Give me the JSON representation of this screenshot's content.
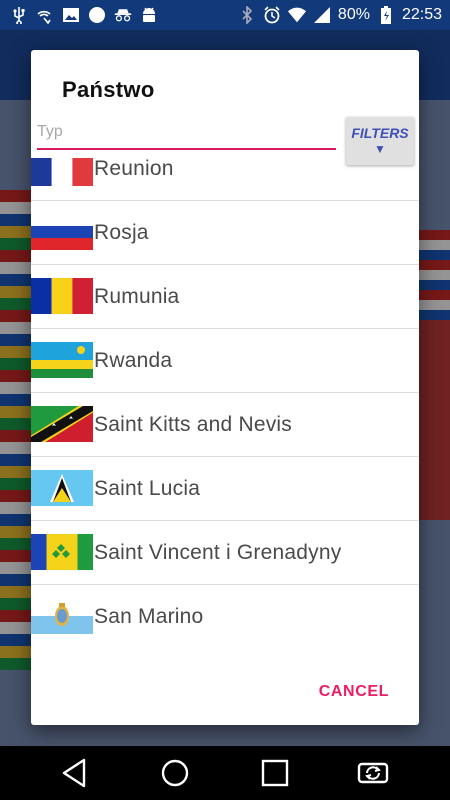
{
  "status_bar": {
    "battery": "80%",
    "time": "22:53",
    "icons": [
      "usb-icon",
      "wifi-calling-icon",
      "image-icon",
      "circle-icon",
      "incognito-icon",
      "android-icon",
      "bluetooth-icon",
      "alarm-icon",
      "wifi-icon",
      "signal-icon",
      "battery-icon"
    ]
  },
  "dialog": {
    "title": "Państwo",
    "search": {
      "placeholder": "Typ",
      "value": ""
    },
    "filters_label": "FILTERS",
    "cancel_label": "CANCEL",
    "countries": [
      {
        "name": "Reunion",
        "flag": "france-flag"
      },
      {
        "name": "Rosja",
        "flag": "russia-flag"
      },
      {
        "name": "Rumunia",
        "flag": "romania-flag"
      },
      {
        "name": "Rwanda",
        "flag": "rwanda-flag"
      },
      {
        "name": "Saint Kitts and Nevis",
        "flag": "saint-kitts-flag"
      },
      {
        "name": "Saint Lucia",
        "flag": "saint-lucia-flag"
      },
      {
        "name": "Saint Vincent i Grenadyny",
        "flag": "saint-vincent-flag"
      },
      {
        "name": "San Marino",
        "flag": "san-marino-flag"
      }
    ]
  },
  "navbar": {
    "icons": [
      "back-icon",
      "home-icon",
      "recents-icon",
      "rotate-icon"
    ]
  },
  "colors": {
    "accent": "#e91e63",
    "filters_text": "#3f51b5",
    "statusbar": "#123a7a"
  }
}
